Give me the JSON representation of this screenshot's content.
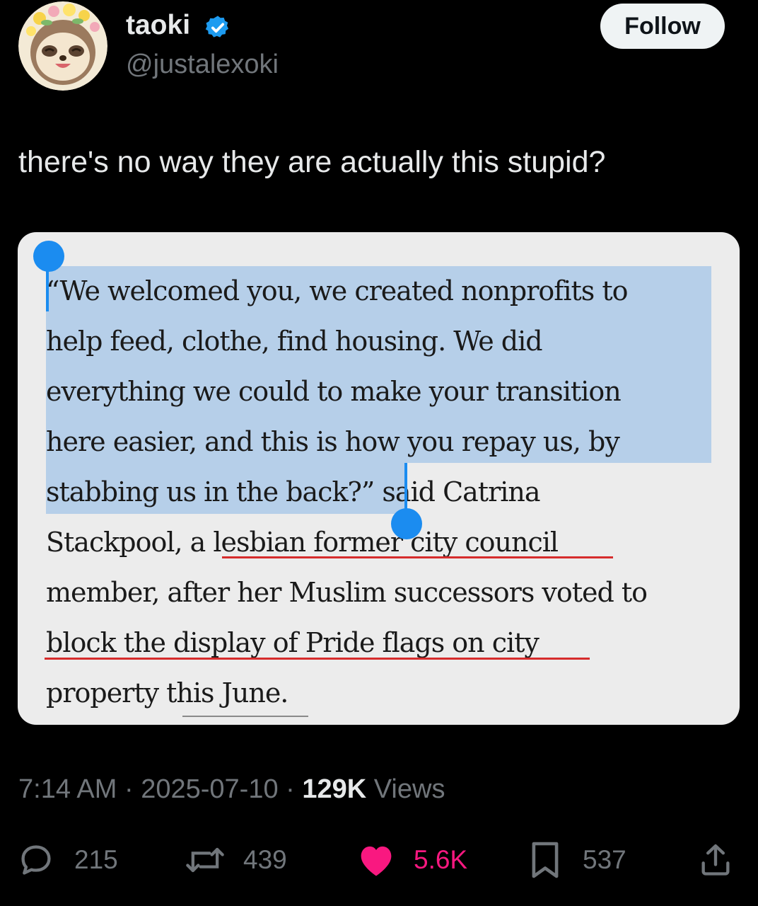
{
  "user": {
    "display_name": "taoki",
    "handle": "@justalexoki",
    "verified": true,
    "avatar_icon": "sloth-avatar"
  },
  "follow_label": "Follow",
  "tweet_text": "there's no way they are actually this stupid?",
  "article_lines": [
    "“We welcomed you, we created nonprofits to",
    "help feed, clothe, find housing. We did",
    "everything we could to make your transition",
    "here easier, and this is how you repay us, by",
    "stabbing us in the back?”",
    " said Catrina",
    "Stackpool, a lesbian former city council",
    "member, after her Muslim successors voted to",
    "block the display of Pride flags on city",
    "property this June."
  ],
  "meta": {
    "time": "7:14 AM",
    "sep1": " · ",
    "date": "2025-07-10",
    "sep2": " · ",
    "views_count": "129K",
    "views_label": " Views"
  },
  "actions": {
    "replies": "215",
    "reposts": "439",
    "likes": "5.6K",
    "bookmarks": "537"
  },
  "colors": {
    "background": "#000000",
    "verified_blue": "#1d9bf0",
    "like_pink": "#f91880",
    "selection_highlight": "#b6cfe9",
    "selection_handle": "#1b8cf0",
    "underline_red": "#d62c2c"
  }
}
